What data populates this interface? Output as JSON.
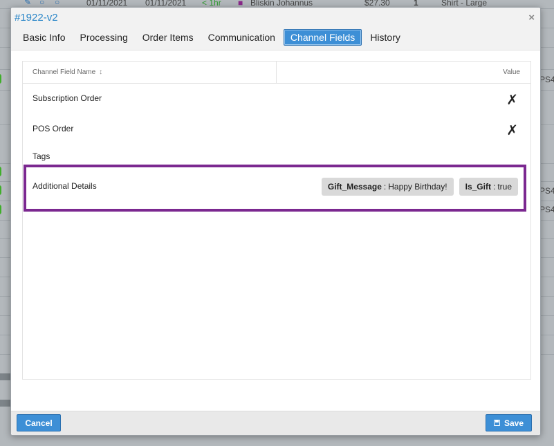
{
  "background": {
    "row_text": {
      "date1": "01/11/2021",
      "date2": "01/11/2021",
      "age": "< 1hr",
      "customer": "Bliskin Johannus",
      "price": "$27.30",
      "qty": "1",
      "product": "Shirt - Large"
    },
    "side_codes": [
      "PS4",
      "PS4",
      "PS4"
    ]
  },
  "modal": {
    "title": "#1922-v2",
    "close_symbol": "×",
    "tabs": [
      {
        "label": "Basic Info",
        "active": false
      },
      {
        "label": "Processing",
        "active": false
      },
      {
        "label": "Order Items",
        "active": false
      },
      {
        "label": "Communication",
        "active": false
      },
      {
        "label": "Channel Fields",
        "active": true
      },
      {
        "label": "History",
        "active": false
      }
    ],
    "table": {
      "col_name": "Channel Field Name",
      "sort_symbol": "↕",
      "col_value": "Value",
      "rows": [
        {
          "label": "Subscription Order",
          "value": "✗"
        },
        {
          "label": "POS Order",
          "value": "✗"
        },
        {
          "label": "Tags",
          "value": ""
        },
        {
          "label": "Additional Details",
          "value": ""
        }
      ],
      "details_tags": [
        {
          "key": "Gift_Message",
          "sep": ":",
          "value": "Happy Birthday!"
        },
        {
          "key": "Is_Gift",
          "sep": ":",
          "value": "true"
        }
      ]
    },
    "footer": {
      "cancel_label": "Cancel",
      "save_label": "Save"
    }
  },
  "colors": {
    "accent": "#3d8fd6",
    "title": "#2a86c8",
    "highlight_border": "#7b2890",
    "status_green": "#3fae2a"
  }
}
